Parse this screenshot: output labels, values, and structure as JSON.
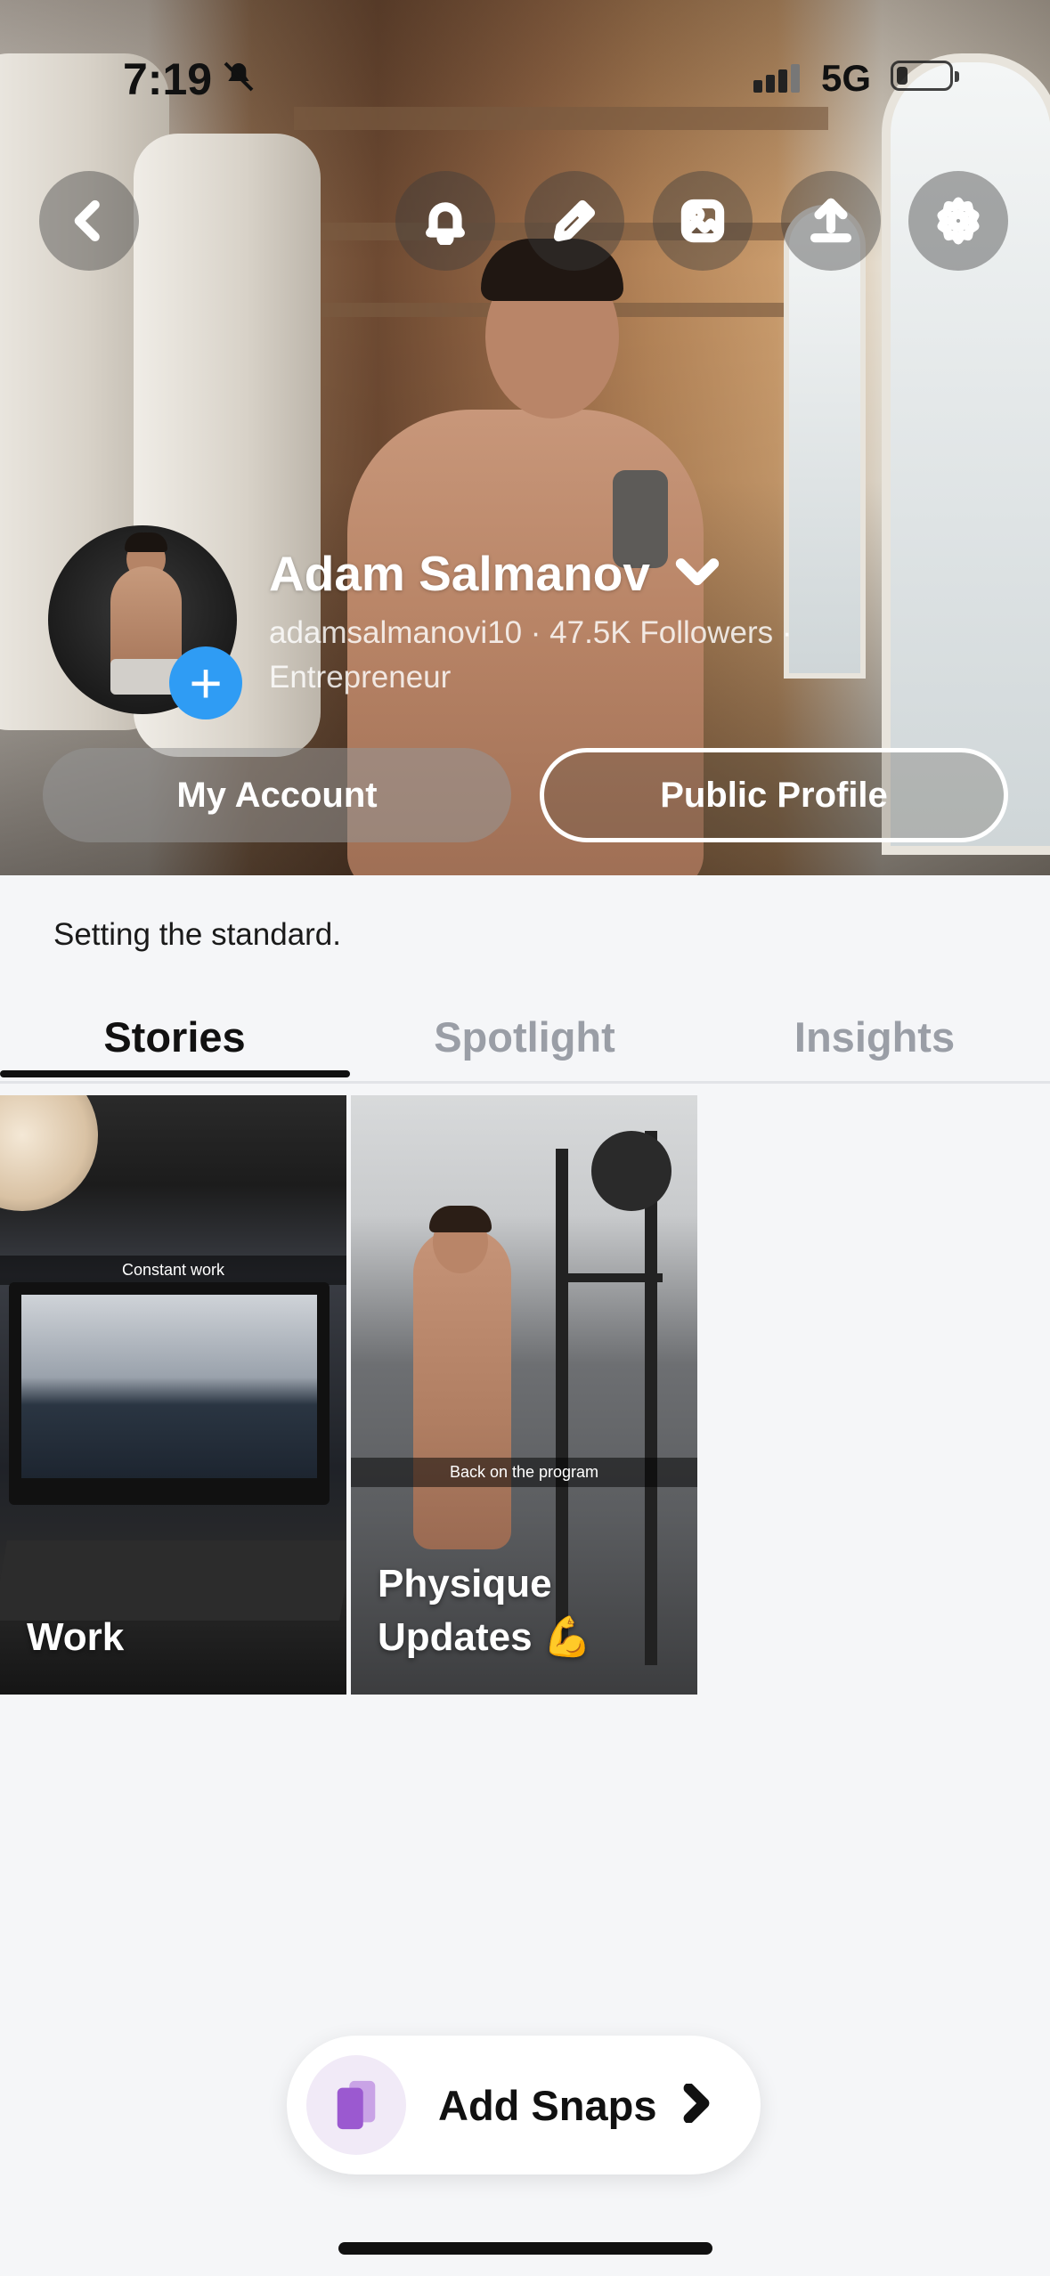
{
  "status_bar": {
    "time": "7:19",
    "network": "5G"
  },
  "header_icons": [
    "back-icon",
    "bell-icon",
    "pencil-icon",
    "image-icon",
    "share-icon",
    "gear-icon"
  ],
  "profile": {
    "name": "Adam Salmanov",
    "meta_line1": "adamsalmanovi10 · 47.5K Followers ·",
    "meta_line2": "Entrepreneur",
    "bio": "Setting the standard."
  },
  "buttons": {
    "my_account": "My Account",
    "public_profile": "Public Profile"
  },
  "tabs": [
    {
      "label": "Stories",
      "active": true
    },
    {
      "label": "Spotlight",
      "active": false
    },
    {
      "label": "Insights",
      "active": false
    }
  ],
  "stories": [
    {
      "caption": "Constant work",
      "title": "Work"
    },
    {
      "caption": "Back on the program",
      "title_line1": "Physique",
      "title_line2": "Updates 💪"
    }
  ],
  "add_snaps": {
    "label": "Add Snaps"
  },
  "colors": {
    "accent_blue": "#2f9cf4",
    "add_snaps_purple": "#9b59d0"
  }
}
